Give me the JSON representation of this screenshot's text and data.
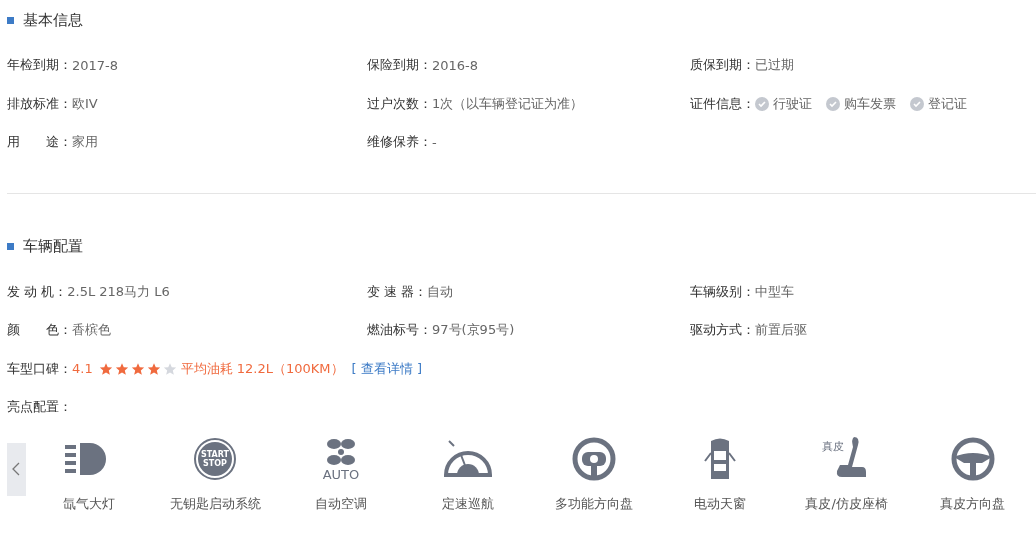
{
  "basic_info": {
    "title": "基本信息",
    "rows": [
      [
        {
          "label": "年检到期：",
          "value": "2017-8"
        },
        {
          "label": "保险到期：",
          "value": "2016-8"
        },
        {
          "label": "质保到期：",
          "value": "已过期"
        }
      ],
      [
        {
          "label": "排放标准：",
          "value": "欧IV"
        },
        {
          "label": "过户次数：",
          "value": "1次（以车辆登记证为准）"
        },
        {
          "label": "证件信息：",
          "documents": [
            "行驶证",
            "购车发票",
            "登记证"
          ]
        }
      ],
      [
        {
          "label": "用　　途：",
          "value": "家用"
        },
        {
          "label": "维修保养：",
          "value": "-"
        }
      ]
    ]
  },
  "vehicle_config": {
    "title": "车辆配置",
    "rows": [
      [
        {
          "label": "发 动 机：",
          "value": "2.5L 218马力 L6"
        },
        {
          "label": "变 速 器：",
          "value": "自动"
        },
        {
          "label": "车辆级别：",
          "value": "中型车"
        }
      ],
      [
        {
          "label": "颜　　色：",
          "value": "香槟色"
        },
        {
          "label": "燃油标号：",
          "value": "97号(京95号)"
        },
        {
          "label": "驱动方式：",
          "value": "前置后驱"
        }
      ]
    ],
    "rating": {
      "label": "车型口碑：",
      "score": "4.1",
      "stars": 4,
      "consumption": "平均油耗 12.2L（100KM）",
      "link": "[ 查看详情 ]"
    },
    "highlights_label": "亮点配置：",
    "features": [
      {
        "kind": "headlight",
        "label": "氙气大灯"
      },
      {
        "kind": "startstop",
        "label": "无钥匙启动系统",
        "icon_text": [
          "START",
          "STOP"
        ]
      },
      {
        "kind": "fan",
        "label": "自动空调",
        "icon_text": [
          "AUTO"
        ]
      },
      {
        "kind": "gauge",
        "label": "定速巡航"
      },
      {
        "kind": "multiwheel",
        "label": "多功能方向盘"
      },
      {
        "kind": "sunroof",
        "label": "电动天窗"
      },
      {
        "kind": "seat",
        "label": "真皮/仿皮座椅",
        "icon_text": [
          "真皮"
        ]
      },
      {
        "kind": "wheel",
        "label": "真皮方向盘"
      }
    ]
  }
}
